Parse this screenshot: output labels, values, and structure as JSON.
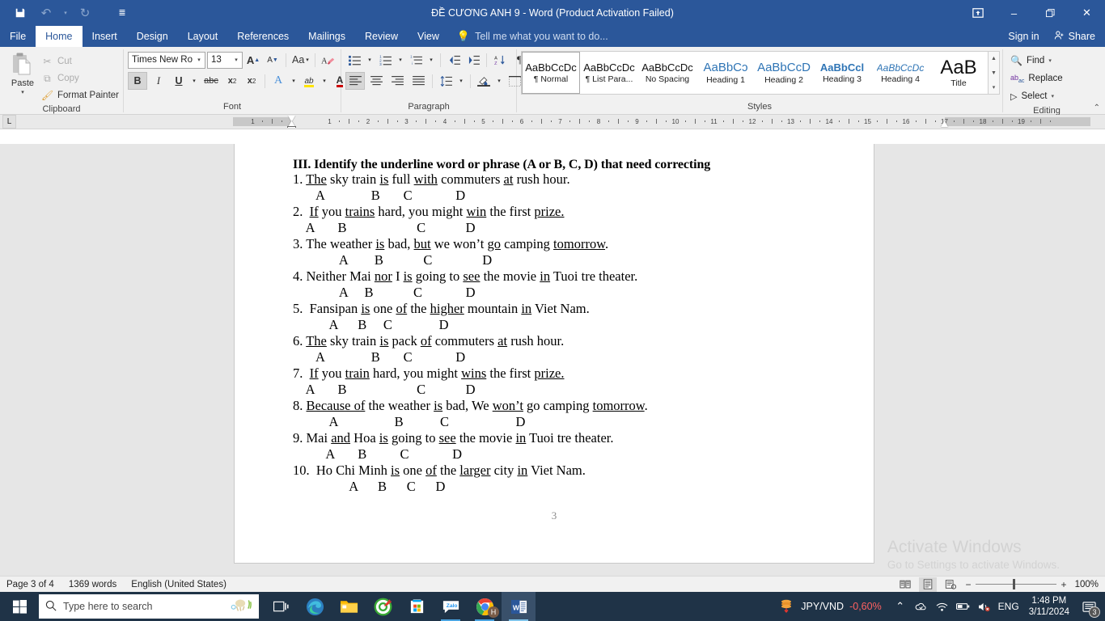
{
  "titlebar": {
    "doc_title": "ĐỀ CƯƠNG  ANH 9 - Word (Product Activation Failed)",
    "quick_access": [
      {
        "name": "save-icon",
        "glyph": "💾"
      },
      {
        "name": "undo-icon",
        "glyph": "↶"
      },
      {
        "name": "undo-dropdown-icon",
        "glyph": "▾"
      },
      {
        "name": "redo-icon",
        "glyph": "↻"
      },
      {
        "name": "customize-qat-icon",
        "glyph": "≡"
      }
    ],
    "window_controls": [
      {
        "name": "ribbon-display-options",
        "label": "⌧"
      },
      {
        "name": "minimize-button",
        "label": "–"
      },
      {
        "name": "restore-button",
        "label": "❐"
      },
      {
        "name": "close-button",
        "label": "✕"
      }
    ]
  },
  "tabs": [
    {
      "label": "File",
      "active": false
    },
    {
      "label": "Home",
      "active": true
    },
    {
      "label": "Insert",
      "active": false
    },
    {
      "label": "Design",
      "active": false
    },
    {
      "label": "Layout",
      "active": false
    },
    {
      "label": "References",
      "active": false
    },
    {
      "label": "Mailings",
      "active": false
    },
    {
      "label": "Review",
      "active": false
    },
    {
      "label": "View",
      "active": false
    }
  ],
  "tellme": "Tell me what you want to do...",
  "signin": "Sign in",
  "share": "Share",
  "ribbon": {
    "clipboard": {
      "group_label": "Clipboard",
      "paste_label": "Paste",
      "items": [
        {
          "label": "Cut",
          "icon": "scissors-icon",
          "glyph": "✂",
          "enabled": false
        },
        {
          "label": "Copy",
          "icon": "copy-icon",
          "glyph": "⧉",
          "enabled": false
        },
        {
          "label": "Format Painter",
          "icon": "format-painter-icon",
          "glyph": "🖌",
          "enabled": true
        }
      ]
    },
    "font": {
      "group_label": "Font",
      "font_name": "Times New Ro",
      "font_size": "13",
      "row1_buttons": [
        {
          "name": "grow-font-button",
          "glyph": "A▴"
        },
        {
          "name": "shrink-font-button",
          "glyph": "A▾"
        },
        {
          "name": "change-case-button",
          "glyph": "Aa"
        },
        {
          "name": "clear-formatting-button",
          "glyph": "✐"
        }
      ],
      "row2_buttons": [
        {
          "name": "bold-button",
          "glyph": "B",
          "selected": true
        },
        {
          "name": "italic-button",
          "glyph": "I",
          "selected": false
        },
        {
          "name": "underline-button",
          "glyph": "U",
          "selected": false
        },
        {
          "name": "strikethrough-button",
          "glyph": "abc",
          "selected": false
        },
        {
          "name": "subscript-button",
          "glyph": "x₂",
          "selected": false
        },
        {
          "name": "superscript-button",
          "glyph": "x²",
          "selected": false
        },
        {
          "name": "text-effects-button",
          "glyph": "A",
          "selected": false
        },
        {
          "name": "text-highlight-color-button",
          "glyph": "ab",
          "selected": false
        },
        {
          "name": "font-color-button",
          "glyph": "A",
          "selected": false
        }
      ]
    },
    "paragraph": {
      "group_label": "Paragraph",
      "row1_buttons": [
        {
          "name": "bullets-button",
          "glyph": "☰"
        },
        {
          "name": "numbering-button",
          "glyph": "☲"
        },
        {
          "name": "multilevel-list-button",
          "glyph": "☳"
        },
        {
          "name": "decrease-indent-button",
          "glyph": "⇤"
        },
        {
          "name": "increase-indent-button",
          "glyph": "⇥"
        },
        {
          "name": "sort-button",
          "glyph": "A↓"
        },
        {
          "name": "show-formatting-marks-button",
          "glyph": "¶"
        }
      ],
      "row2_buttons": [
        {
          "name": "align-left-button",
          "glyph": "≡",
          "selected": true
        },
        {
          "name": "align-center-button",
          "glyph": "≡",
          "selected": false
        },
        {
          "name": "align-right-button",
          "glyph": "≡",
          "selected": false
        },
        {
          "name": "justify-button",
          "glyph": "≡",
          "selected": false
        },
        {
          "name": "line-spacing-button",
          "glyph": "↕",
          "selected": false
        },
        {
          "name": "shading-button",
          "glyph": "▣",
          "selected": false
        },
        {
          "name": "borders-button",
          "glyph": "▦",
          "selected": false
        }
      ]
    },
    "styles": {
      "group_label": "Styles",
      "items": [
        {
          "preview": "AaBbCcDc",
          "name": "¶ Normal",
          "selected": true,
          "style": "normal"
        },
        {
          "preview": "AaBbCcDc",
          "name": "¶ List Para...",
          "selected": false,
          "style": "normal"
        },
        {
          "preview": "AaBbCcDc",
          "name": "No Spacing",
          "selected": false,
          "style": "normal"
        },
        {
          "preview": "AaBbCɔ",
          "name": "Heading 1",
          "selected": false,
          "style": "h1"
        },
        {
          "preview": "AaBbCcD",
          "name": "Heading 2",
          "selected": false,
          "style": "h2"
        },
        {
          "preview": "AaBbCcl",
          "name": "Heading 3",
          "selected": false,
          "style": "h3"
        },
        {
          "preview": "AaBbCcDc",
          "name": "Heading 4",
          "selected": false,
          "style": "h4"
        },
        {
          "preview": "AaB",
          "name": "Title",
          "selected": false,
          "style": "title"
        }
      ]
    },
    "editing": {
      "group_label": "Editing",
      "items": [
        {
          "label": "Find",
          "icon": "search-icon",
          "glyph": "🔍",
          "caret": true
        },
        {
          "label": "Replace",
          "icon": "replace-icon",
          "glyph": "ab",
          "caret": false
        },
        {
          "label": "Select",
          "icon": "select-icon",
          "glyph": "↖",
          "caret": true
        }
      ]
    },
    "collapse_label": "⌃"
  },
  "ruler": {
    "tabstop_glyph": "L",
    "labels": [
      "2",
      "1",
      "1",
      "2",
      "3",
      "4",
      "5",
      "6",
      "7",
      "8",
      "9",
      "10",
      "11",
      "12",
      "13",
      "14",
      "15",
      "16",
      "18"
    ]
  },
  "document": {
    "heading": "III. Identify the underline word or phrase (A or B, C, D) that need correcting",
    "questions": [
      {
        "number": "1.",
        "segments": [
          {
            "t": " ",
            "u": false
          },
          {
            "t": "The",
            "u": true
          },
          {
            "t": " sky train ",
            "u": false
          },
          {
            "t": "is",
            "u": true
          },
          {
            "t": " full ",
            "u": false
          },
          {
            "t": "with",
            "u": true
          },
          {
            "t": " commuters ",
            "u": false
          },
          {
            "t": "at",
            "u": true
          },
          {
            "t": " rush hour.",
            "u": false
          }
        ],
        "options_line": "       A              B       C             D"
      },
      {
        "number": "2.",
        "segments": [
          {
            "t": "  ",
            "u": false
          },
          {
            "t": "If",
            "u": true
          },
          {
            "t": " you ",
            "u": false
          },
          {
            "t": "trains",
            "u": true
          },
          {
            "t": " hard, you might ",
            "u": false
          },
          {
            "t": "win",
            "u": true
          },
          {
            "t": " the first ",
            "u": false
          },
          {
            "t": "prize.",
            "u": true
          }
        ],
        "options_line": "    A       B                     C            D"
      },
      {
        "number": "3.",
        "segments": [
          {
            "t": " The weather ",
            "u": false
          },
          {
            "t": "is",
            "u": true
          },
          {
            "t": " bad, ",
            "u": false
          },
          {
            "t": "but",
            "u": true
          },
          {
            "t": " we won’t ",
            "u": false
          },
          {
            "t": "go",
            "u": true
          },
          {
            "t": " camping ",
            "u": false
          },
          {
            "t": "tomorrow",
            "u": true
          },
          {
            "t": ".",
            "u": false
          }
        ],
        "options_line": "              A        B            C               D"
      },
      {
        "number": "4.",
        "segments": [
          {
            "t": " Neither Mai ",
            "u": false
          },
          {
            "t": "nor",
            "u": true
          },
          {
            "t": " I ",
            "u": false
          },
          {
            "t": "is",
            "u": true
          },
          {
            "t": " going to ",
            "u": false
          },
          {
            "t": "see",
            "u": true
          },
          {
            "t": " the movie ",
            "u": false
          },
          {
            "t": "in",
            "u": true
          },
          {
            "t": " Tuoi tre theater.",
            "u": false
          }
        ],
        "options_line": "              A     B            C             D"
      },
      {
        "number": "5.",
        "segments": [
          {
            "t": "  Fansipan ",
            "u": false
          },
          {
            "t": "is",
            "u": true
          },
          {
            "t": " one ",
            "u": false
          },
          {
            "t": "of",
            "u": true
          },
          {
            "t": " the ",
            "u": false
          },
          {
            "t": "higher",
            "u": true
          },
          {
            "t": " mountain ",
            "u": false
          },
          {
            "t": "in",
            "u": true
          },
          {
            "t": " Viet Nam.",
            "u": false
          }
        ],
        "options_line": "           A      B     C              D"
      },
      {
        "number": "6.",
        "segments": [
          {
            "t": " ",
            "u": false
          },
          {
            "t": "The",
            "u": true
          },
          {
            "t": " sky train ",
            "u": false
          },
          {
            "t": "is",
            "u": true
          },
          {
            "t": " pack ",
            "u": false
          },
          {
            "t": "of",
            "u": true
          },
          {
            "t": " commuters ",
            "u": false
          },
          {
            "t": "at",
            "u": true
          },
          {
            "t": " rush hour.",
            "u": false
          }
        ],
        "options_line": "       A              B       C             D"
      },
      {
        "number": "7.",
        "segments": [
          {
            "t": "  ",
            "u": false
          },
          {
            "t": "If",
            "u": true
          },
          {
            "t": " you ",
            "u": false
          },
          {
            "t": "train",
            "u": true
          },
          {
            "t": " hard, you might ",
            "u": false
          },
          {
            "t": "wins",
            "u": true
          },
          {
            "t": " the first ",
            "u": false
          },
          {
            "t": "prize.",
            "u": true
          }
        ],
        "options_line": "    A       B                     C            D"
      },
      {
        "number": "8.",
        "segments": [
          {
            "t": " ",
            "u": false
          },
          {
            "t": "Because of",
            "u": true
          },
          {
            "t": " the weather ",
            "u": false
          },
          {
            "t": "is",
            "u": true
          },
          {
            "t": " bad, We ",
            "u": false
          },
          {
            "t": "won’t",
            "u": true
          },
          {
            "t": " go camping ",
            "u": false
          },
          {
            "t": "tomorrow",
            "u": true
          },
          {
            "t": ".",
            "u": false
          }
        ],
        "options_line": "           A                 B           C                    D"
      },
      {
        "number": "9.",
        "segments": [
          {
            "t": " Mai ",
            "u": false
          },
          {
            "t": "and",
            "u": true
          },
          {
            "t": " Hoa ",
            "u": false
          },
          {
            "t": "is",
            "u": true
          },
          {
            "t": " going to ",
            "u": false
          },
          {
            "t": "see",
            "u": true
          },
          {
            "t": " the movie ",
            "u": false
          },
          {
            "t": "in",
            "u": true
          },
          {
            "t": " Tuoi tre theater.",
            "u": false
          }
        ],
        "options_line": "          A       B          C             D"
      },
      {
        "number": "10.",
        "segments": [
          {
            "t": "  Ho Chi Minh ",
            "u": false
          },
          {
            "t": "is",
            "u": true
          },
          {
            "t": " one ",
            "u": false
          },
          {
            "t": "of",
            "u": true
          },
          {
            "t": " the ",
            "u": false
          },
          {
            "t": "larger",
            "u": true
          },
          {
            "t": " city ",
            "u": false
          },
          {
            "t": "in",
            "u": true
          },
          {
            "t": " Viet Nam.",
            "u": false
          }
        ],
        "options_line": "                 A      B      C      D"
      }
    ],
    "page_number": "3"
  },
  "watermark": {
    "line1": "Activate Windows",
    "line2": "Go to Settings to activate Windows."
  },
  "statusbar": {
    "page": "Page 3 of 4",
    "words": "1369 words",
    "language": "English (United States)",
    "views": [
      {
        "name": "read-mode-button",
        "glyph": "📖",
        "active": false
      },
      {
        "name": "print-layout-button",
        "glyph": "▤",
        "active": true
      },
      {
        "name": "web-layout-button",
        "glyph": "▧",
        "active": false
      }
    ],
    "zoom_out": "−",
    "zoom_in": "+",
    "zoom_level": "100%"
  },
  "taskbar": {
    "search_placeholder": "Type here to search",
    "apps": [
      {
        "name": "task-view-icon",
        "label": "Task View"
      },
      {
        "name": "microsoft-edge-icon",
        "label": "Microsoft Edge"
      },
      {
        "name": "file-explorer-icon",
        "label": "File Explorer"
      },
      {
        "name": "unikey-icon",
        "label": "UniKey"
      },
      {
        "name": "microsoft-store-icon",
        "label": "Microsoft Store"
      },
      {
        "name": "zalo-icon",
        "label": "Zalo"
      },
      {
        "name": "google-chrome-icon",
        "label": "Google Chrome"
      },
      {
        "name": "word-taskbar-icon",
        "label": "Word"
      }
    ],
    "stock": {
      "symbol": "JPY/VND",
      "change": "-0,60%"
    },
    "tray": [
      {
        "name": "show-hidden-icons-icon",
        "glyph": "⌃"
      },
      {
        "name": "onedrive-icon",
        "glyph": "☁"
      },
      {
        "name": "network-icon",
        "glyph": "📶"
      },
      {
        "name": "battery-icon",
        "glyph": "🔋"
      },
      {
        "name": "volume-muted-icon",
        "glyph": "🔇"
      }
    ],
    "input_language": "ENG",
    "time": "1:48 PM",
    "date": "3/11/2024",
    "notification_count": "3"
  },
  "colors": {
    "word_blue": "#2b579a",
    "ribbon_bg": "#f1f1f1",
    "taskbar": "#1f3347",
    "accent_blue": "#2e74b5"
  }
}
